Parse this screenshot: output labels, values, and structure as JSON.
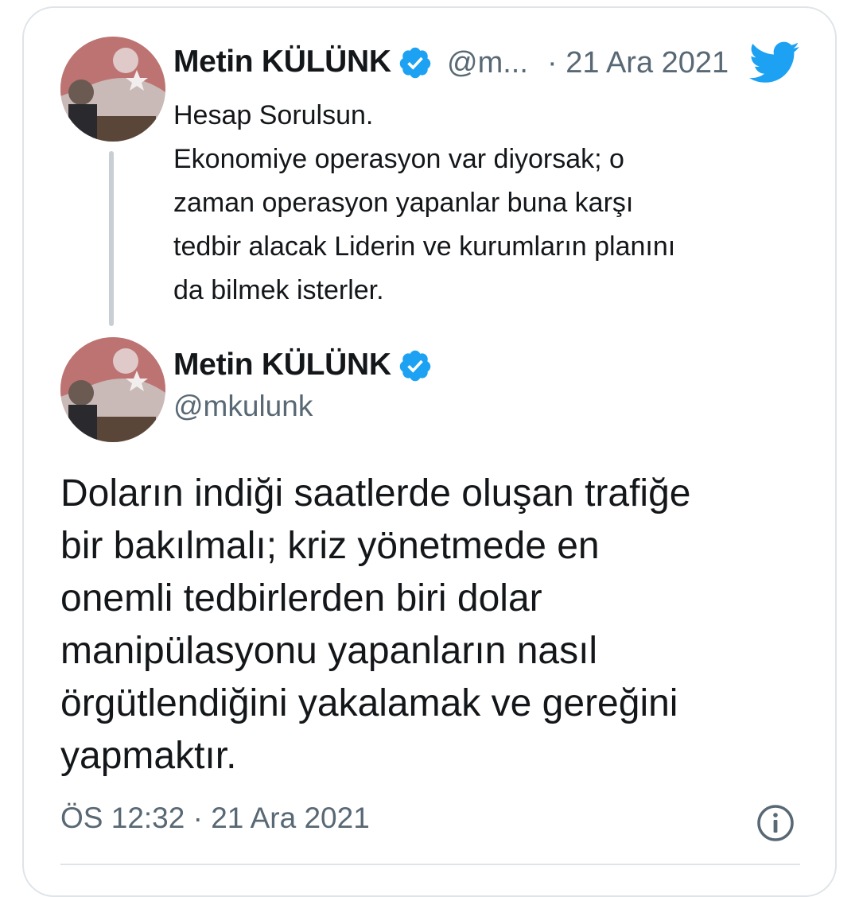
{
  "colors": {
    "twitter_blue": "#1da1f2",
    "text_primary": "#14171a",
    "text_secondary": "#586874",
    "border": "#dfe4e8"
  },
  "quoted_tweet": {
    "author_name": "Metin KÜLÜNK",
    "handle_truncated": "@m...",
    "date": "· 21 Ara 2021",
    "text_lines": [
      "Hesap Sorulsun.",
      "Ekonomiye operasyon var diyorsak; o",
      "zaman operasyon yapanlar buna karşı",
      "tedbir alacak Liderin ve kurumların planını",
      "da bilmek isterler."
    ],
    "icons": [
      "verified-badge-icon",
      "twitter-bird-icon"
    ]
  },
  "main_tweet": {
    "author_name": "Metin KÜLÜNK",
    "handle": "@mkulunk",
    "text_lines": [
      "Doların indiği saatlerde oluşan trafiğe",
      "bir bakılmalı; kriz yönetmede en",
      "onemli tedbirlerden biri dolar",
      "manipülasyonu yapanların nasıl",
      "örgütlendiğini yakalamak ve gereğini",
      "yapmaktır."
    ],
    "timestamp": "ÖS 12:32 · 21 Ara 2021",
    "icons": [
      "verified-badge-icon",
      "info-icon"
    ]
  }
}
